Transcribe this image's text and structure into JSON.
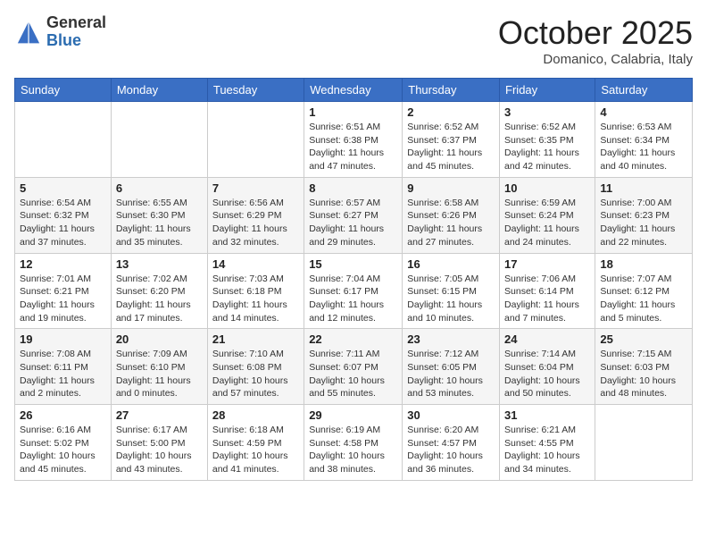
{
  "logo": {
    "general": "General",
    "blue": "Blue"
  },
  "title": "October 2025",
  "subtitle": "Domanico, Calabria, Italy",
  "weekdays": [
    "Sunday",
    "Monday",
    "Tuesday",
    "Wednesday",
    "Thursday",
    "Friday",
    "Saturday"
  ],
  "weeks": [
    [
      {
        "day": "",
        "info": ""
      },
      {
        "day": "",
        "info": ""
      },
      {
        "day": "",
        "info": ""
      },
      {
        "day": "1",
        "info": "Sunrise: 6:51 AM\nSunset: 6:38 PM\nDaylight: 11 hours and 47 minutes."
      },
      {
        "day": "2",
        "info": "Sunrise: 6:52 AM\nSunset: 6:37 PM\nDaylight: 11 hours and 45 minutes."
      },
      {
        "day": "3",
        "info": "Sunrise: 6:52 AM\nSunset: 6:35 PM\nDaylight: 11 hours and 42 minutes."
      },
      {
        "day": "4",
        "info": "Sunrise: 6:53 AM\nSunset: 6:34 PM\nDaylight: 11 hours and 40 minutes."
      }
    ],
    [
      {
        "day": "5",
        "info": "Sunrise: 6:54 AM\nSunset: 6:32 PM\nDaylight: 11 hours and 37 minutes."
      },
      {
        "day": "6",
        "info": "Sunrise: 6:55 AM\nSunset: 6:30 PM\nDaylight: 11 hours and 35 minutes."
      },
      {
        "day": "7",
        "info": "Sunrise: 6:56 AM\nSunset: 6:29 PM\nDaylight: 11 hours and 32 minutes."
      },
      {
        "day": "8",
        "info": "Sunrise: 6:57 AM\nSunset: 6:27 PM\nDaylight: 11 hours and 29 minutes."
      },
      {
        "day": "9",
        "info": "Sunrise: 6:58 AM\nSunset: 6:26 PM\nDaylight: 11 hours and 27 minutes."
      },
      {
        "day": "10",
        "info": "Sunrise: 6:59 AM\nSunset: 6:24 PM\nDaylight: 11 hours and 24 minutes."
      },
      {
        "day": "11",
        "info": "Sunrise: 7:00 AM\nSunset: 6:23 PM\nDaylight: 11 hours and 22 minutes."
      }
    ],
    [
      {
        "day": "12",
        "info": "Sunrise: 7:01 AM\nSunset: 6:21 PM\nDaylight: 11 hours and 19 minutes."
      },
      {
        "day": "13",
        "info": "Sunrise: 7:02 AM\nSunset: 6:20 PM\nDaylight: 11 hours and 17 minutes."
      },
      {
        "day": "14",
        "info": "Sunrise: 7:03 AM\nSunset: 6:18 PM\nDaylight: 11 hours and 14 minutes."
      },
      {
        "day": "15",
        "info": "Sunrise: 7:04 AM\nSunset: 6:17 PM\nDaylight: 11 hours and 12 minutes."
      },
      {
        "day": "16",
        "info": "Sunrise: 7:05 AM\nSunset: 6:15 PM\nDaylight: 11 hours and 10 minutes."
      },
      {
        "day": "17",
        "info": "Sunrise: 7:06 AM\nSunset: 6:14 PM\nDaylight: 11 hours and 7 minutes."
      },
      {
        "day": "18",
        "info": "Sunrise: 7:07 AM\nSunset: 6:12 PM\nDaylight: 11 hours and 5 minutes."
      }
    ],
    [
      {
        "day": "19",
        "info": "Sunrise: 7:08 AM\nSunset: 6:11 PM\nDaylight: 11 hours and 2 minutes."
      },
      {
        "day": "20",
        "info": "Sunrise: 7:09 AM\nSunset: 6:10 PM\nDaylight: 11 hours and 0 minutes."
      },
      {
        "day": "21",
        "info": "Sunrise: 7:10 AM\nSunset: 6:08 PM\nDaylight: 10 hours and 57 minutes."
      },
      {
        "day": "22",
        "info": "Sunrise: 7:11 AM\nSunset: 6:07 PM\nDaylight: 10 hours and 55 minutes."
      },
      {
        "day": "23",
        "info": "Sunrise: 7:12 AM\nSunset: 6:05 PM\nDaylight: 10 hours and 53 minutes."
      },
      {
        "day": "24",
        "info": "Sunrise: 7:14 AM\nSunset: 6:04 PM\nDaylight: 10 hours and 50 minutes."
      },
      {
        "day": "25",
        "info": "Sunrise: 7:15 AM\nSunset: 6:03 PM\nDaylight: 10 hours and 48 minutes."
      }
    ],
    [
      {
        "day": "26",
        "info": "Sunrise: 6:16 AM\nSunset: 5:02 PM\nDaylight: 10 hours and 45 minutes."
      },
      {
        "day": "27",
        "info": "Sunrise: 6:17 AM\nSunset: 5:00 PM\nDaylight: 10 hours and 43 minutes."
      },
      {
        "day": "28",
        "info": "Sunrise: 6:18 AM\nSunset: 4:59 PM\nDaylight: 10 hours and 41 minutes."
      },
      {
        "day": "29",
        "info": "Sunrise: 6:19 AM\nSunset: 4:58 PM\nDaylight: 10 hours and 38 minutes."
      },
      {
        "day": "30",
        "info": "Sunrise: 6:20 AM\nSunset: 4:57 PM\nDaylight: 10 hours and 36 minutes."
      },
      {
        "day": "31",
        "info": "Sunrise: 6:21 AM\nSunset: 4:55 PM\nDaylight: 10 hours and 34 minutes."
      },
      {
        "day": "",
        "info": ""
      }
    ]
  ]
}
